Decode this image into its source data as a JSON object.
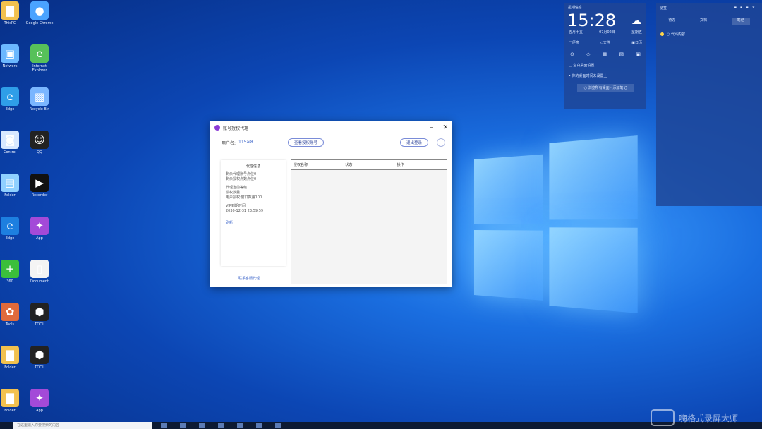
{
  "desktop_icons": [
    {
      "id": "i1",
      "label": "ThisPC",
      "color": "#f2c14e",
      "glyph": "▇"
    },
    {
      "id": "i2",
      "label": "Google Chrome",
      "color": "#4aa3ff",
      "glyph": "●"
    },
    {
      "id": "i3",
      "label": "Network",
      "color": "#6bb8ff",
      "glyph": "▣"
    },
    {
      "id": "i4",
      "label": "Internet Explorer",
      "color": "#57c15a",
      "glyph": "e"
    },
    {
      "id": "i5",
      "label": "Edge",
      "color": "#2f9ee8",
      "glyph": "e"
    },
    {
      "id": "i6",
      "label": "Recycle Bin",
      "color": "#7ab6ff",
      "glyph": "▩"
    },
    {
      "id": "i7",
      "label": "Control",
      "color": "#d8e8ff",
      "glyph": "◙"
    },
    {
      "id": "i8",
      "label": "QQ",
      "color": "#222",
      "glyph": "☺"
    },
    {
      "id": "i9",
      "label": "Folder",
      "color": "#8fd0ff",
      "glyph": "▤"
    },
    {
      "id": "i10",
      "label": "Recorder",
      "color": "#111",
      "glyph": "▶"
    },
    {
      "id": "i11",
      "label": "Edge",
      "color": "#1d7fe0",
      "glyph": "e"
    },
    {
      "id": "i12",
      "label": "App",
      "color": "#a34ad8",
      "glyph": "✦"
    },
    {
      "id": "i13",
      "label": "360",
      "color": "#3bbf3b",
      "glyph": "+"
    },
    {
      "id": "i14",
      "label": "Document",
      "color": "#f4f4f4",
      "glyph": "▯"
    },
    {
      "id": "i15",
      "label": "Tools",
      "color": "#e06a3b",
      "glyph": "✿"
    },
    {
      "id": "i16",
      "label": "TOOL",
      "color": "#222",
      "glyph": "⬢"
    },
    {
      "id": "i17",
      "label": "Folder",
      "color": "#f2c14e",
      "glyph": "▇"
    },
    {
      "id": "i18",
      "label": "TOOL",
      "color": "#222",
      "glyph": "⬢"
    },
    {
      "id": "i19",
      "label": "Folder",
      "color": "#f2c14e",
      "glyph": "▇"
    },
    {
      "id": "i20",
      "label": "App",
      "color": "#a34ad8",
      "glyph": "✦"
    }
  ],
  "app": {
    "title": "账号授权代理",
    "username_label": "用户名:",
    "username_value": "115ai8",
    "btn_open": "查看授权账号",
    "btn_logout": "退出登录",
    "sidebar": {
      "heading": "代理信息",
      "lines1": [
        "剩余代理账号点位0",
        "剩余授权点数点位0"
      ],
      "lines2": [
        "代理当前等级",
        "授权数量",
        "用户授权:窗口数量100"
      ],
      "lines3": [
        "VIP到期时间",
        "2030-12-31 23:59:59"
      ],
      "more": "刷新一"
    },
    "sidebar_footer": "联系客服代理",
    "table_headers": [
      "授权名称",
      "状态",
      "操作"
    ]
  },
  "widget": {
    "title": "星期信息",
    "time": "15:28",
    "weather_icon": "☁",
    "date_left": "五月十五",
    "date_mid": "07月02日",
    "date_right": "星期五",
    "menu": [
      "□便签",
      "◇文件",
      "▣日历"
    ],
    "icons": [
      "⊙",
      "◇",
      "▦",
      "▧",
      "▣"
    ],
    "line1": "□ 空白桌面设置",
    "line2": "• 你的桌面时间未设置上",
    "btn": "○ 浏览所有桌面 · 添加笔记"
  },
  "panel": {
    "title": "便签",
    "controls": "▪▪▪✕",
    "tabs": [
      "待办",
      "文档",
      "笔记"
    ],
    "item": "○ 代码内容"
  },
  "taskbar": {
    "search_placeholder": "在这里输入你要搜索的内容"
  },
  "watermark": "嗨格式录屏大师"
}
